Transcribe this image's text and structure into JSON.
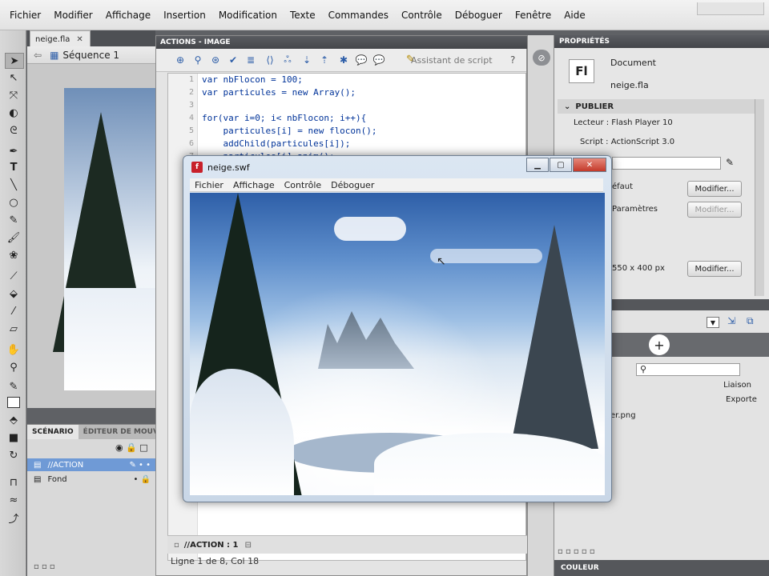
{
  "menu": [
    "Fichier",
    "Modifier",
    "Affichage",
    "Insertion",
    "Modification",
    "Texte",
    "Commandes",
    "Contrôle",
    "Déboguer",
    "Fenêtre",
    "Aide"
  ],
  "document": {
    "tab": "neige.fla",
    "scene": "Séquence 1"
  },
  "timeline": {
    "tab_scenario": "SCÉNARIO",
    "tab_editor": "ÉDITEUR DE MOUVEI",
    "layers": [
      "//ACTION",
      "Fond"
    ]
  },
  "actions": {
    "title": "ACTIONS - IMAGE",
    "assistant": "Assistant de script",
    "code_lines": [
      "var nbFlocon = 100;",
      "var particules = new Array();",
      "",
      "for(var i=0; i< nbFlocon; i++){",
      "    particules[i] = new flocon();",
      "    addChild(particules[i]);",
      "    particules[i].anim();"
    ],
    "line_numbers": [
      "1",
      "2",
      "3",
      "4",
      "5",
      "6",
      "7"
    ],
    "footer_tab": "//ACTION : 1",
    "status": "Ligne 1 de 8, Col 18"
  },
  "properties": {
    "title": "PROPRIÉTÉS",
    "doc_type": "Document",
    "doc_icon": "Fl",
    "doc_name": "neige.fla",
    "section_publish": "PUBLIER",
    "player_label": "Lecteur : Flash Player 10",
    "script_label": "Script : ActionScript 3.0",
    "defaut": "éfaut",
    "params": "Paramètres",
    "size": "550 x 400 px",
    "modify1": "Modifier...",
    "modify2": "Modifier...",
    "modify3": "Modifier..."
  },
  "library": {
    "liaison": "Liaison",
    "export": "Exporte",
    "item": "er.png"
  },
  "couleur": "COULEUR",
  "swf": {
    "title": "neige.swf",
    "menu": [
      "Fichier",
      "Affichage",
      "Contrôle",
      "Déboguer"
    ]
  }
}
